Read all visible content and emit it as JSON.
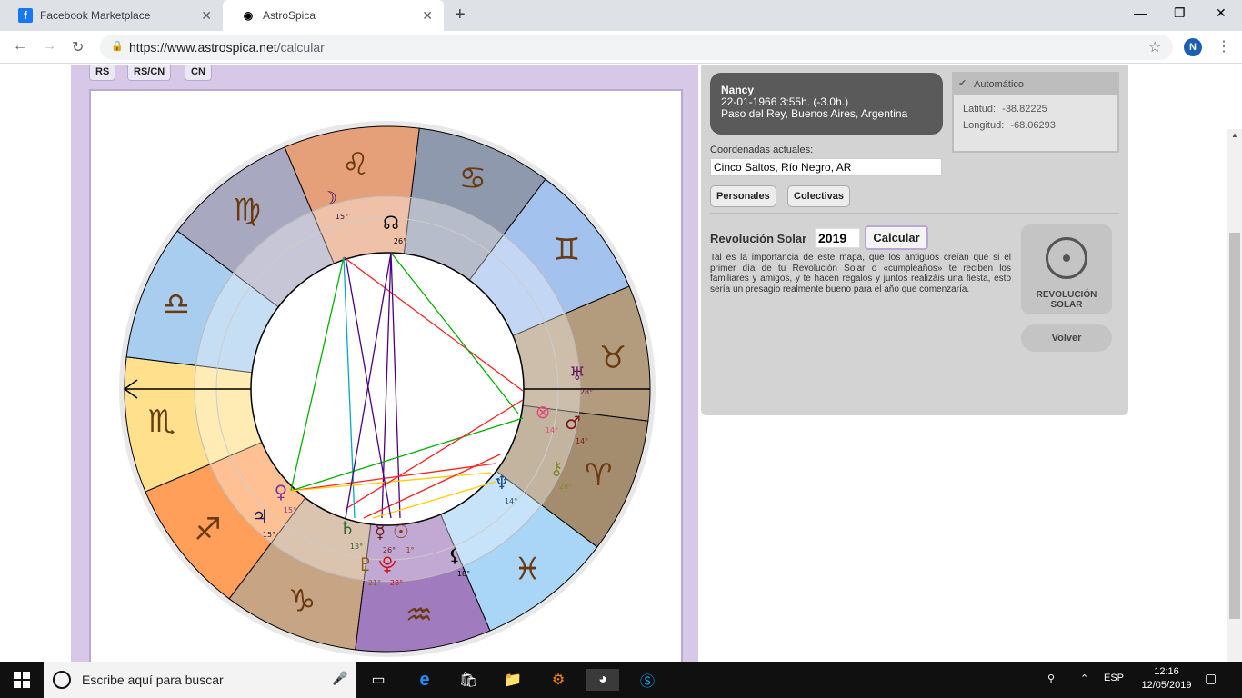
{
  "browser": {
    "tabs": [
      {
        "title": "Facebook Marketplace",
        "icon": "facebook-icon",
        "color": "#1877f2"
      },
      {
        "title": "AstroSpica",
        "icon": "eye-icon"
      }
    ],
    "url_host": "https://www.astrospica.net",
    "url_path": "/calcular",
    "profile_initial": "N"
  },
  "chart_tabs": [
    "RS",
    "RS/CN",
    "CN"
  ],
  "profile": {
    "name": "Nancy",
    "datetime": "22-01-1966 3:55h. (-3.0h.)",
    "place": "Paso del Rey, Buenos Aires, Argentina"
  },
  "auto": {
    "label": "Automático",
    "lat_label": "Latitud:",
    "lat": "-38.82225",
    "lon_label": "Longitud:",
    "lon": "-68.06293"
  },
  "coords": {
    "label": "Coordenadas actuales:",
    "value": "Cinco Saltos, Río Negro, AR"
  },
  "buttons": {
    "personales": "Personales",
    "colectivas": "Colectivas",
    "calcular": "Calcular",
    "volver": "Volver",
    "rs_button": "REVOLUCIÓN SOLAR"
  },
  "revolucion": {
    "label": "Revolución Solar",
    "year": "2019",
    "description": "Tal es la importancia de este mapa, que los antiguos creían que si el primer día de tu Revolución Solar o «cumpleaños» te reciben los familiares y amigos, y te hacen regalos y juntos realizáis una fiesta, esto sería un presagio realmente bueno para el año que comenzaría."
  },
  "wheel": {
    "signs": [
      "♋",
      "♊",
      "♉",
      "♈",
      "♓",
      "♒",
      "♑",
      "♐",
      "♏",
      "♎",
      "♍",
      "♌"
    ],
    "sign_colors": [
      "#8f99ae",
      "#a3c2ee",
      "#b39c7e",
      "#a48c6e",
      "#a9d5f6",
      "#a07bbd",
      "#c7a484",
      "#ff9f5a",
      "#ffe08c",
      "#a8cdee",
      "#a8a8c0",
      "#e5a07a"
    ],
    "planets": [
      {
        "glyph": "☽",
        "deg": "15°"
      },
      {
        "glyph": "☊",
        "deg": "26°"
      },
      {
        "glyph": "♅",
        "deg": "28°"
      },
      {
        "glyph": "⊗",
        "deg": "14°"
      },
      {
        "glyph": "♂",
        "deg": "14°"
      },
      {
        "glyph": "⚷",
        "deg": "28°"
      },
      {
        "glyph": "♆",
        "deg": "14°"
      },
      {
        "glyph": "⚸",
        "deg": "18°"
      },
      {
        "glyph": "☉",
        "deg": "1°"
      },
      {
        "glyph": "☿",
        "deg": "26°"
      },
      {
        "glyph": "⯓",
        "deg": "28°"
      },
      {
        "glyph": "♇",
        "deg": "21°"
      },
      {
        "glyph": "♄",
        "deg": "13°"
      },
      {
        "glyph": "♃",
        "deg": "15°"
      },
      {
        "glyph": "♀",
        "deg": "15°"
      }
    ]
  },
  "taskbar": {
    "search_placeholder": "Escribe aquí para buscar",
    "lang": "ESP",
    "time": "12:16",
    "date": "12/05/2019"
  }
}
